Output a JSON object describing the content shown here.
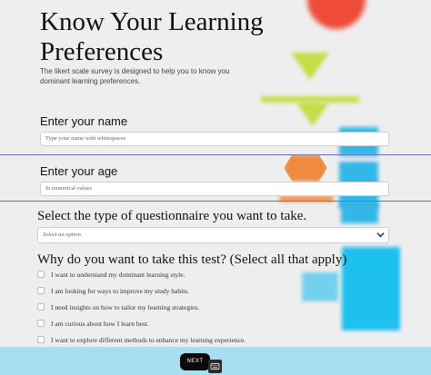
{
  "header": {
    "title": "Know Your Learning Preferences",
    "subtitle": "The likert scale survey is designed to help you to know you dominant learning preferences."
  },
  "name_field": {
    "label": "Enter your name",
    "placeholder": "Type your name with whitespaces"
  },
  "age_field": {
    "label": "Enter your age",
    "placeholder": "In numerical values"
  },
  "questionnaire": {
    "label": "Select the type of questionnaire you want to take.",
    "selected": "Select an option",
    "icon": "chevron-down-icon"
  },
  "reasons": {
    "label": "Why do you want to take this test? (Select all that apply)",
    "options": [
      "I want to understand my dominant learning style.",
      "I am looking for ways to improve my study habits.",
      "I need insights on how to tailor my learning strategies.",
      "I am curious about how I learn best.",
      "I want to explore different methods to enhance my learning experience."
    ]
  },
  "footer": {
    "next_label": "NEXT",
    "keyboard_icon": "keyboard-icon"
  },
  "colors": {
    "footer_bg": "#a9ddf0",
    "button_bg": "#0a0a0a",
    "accent_blue": "#1ec0ee",
    "accent_green": "#c6dc48",
    "accent_orange": "#f08a3e",
    "accent_red": "#ee4b39",
    "divider": "#6f6fb6"
  }
}
